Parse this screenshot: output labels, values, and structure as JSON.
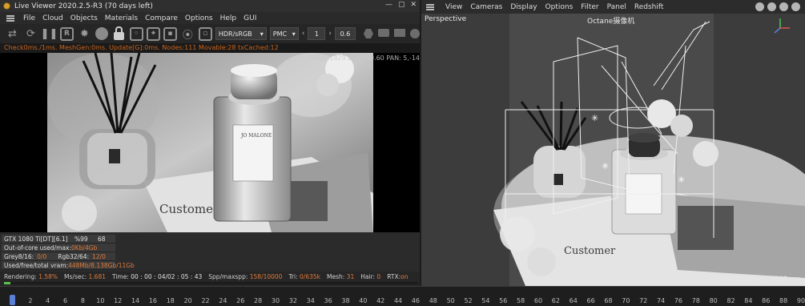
{
  "live_viewer": {
    "title": "Live Viewer 2020.2.5-R3 (70 days left)",
    "menu": [
      "File",
      "Cloud",
      "Objects",
      "Materials",
      "Compare",
      "Options",
      "Help",
      "GUI"
    ],
    "toolbar": {
      "color_space": "HDR/sRGB",
      "kernel": "PMC",
      "stepper_value": "1",
      "zoom_value": "0.6"
    },
    "status_line": "Check0ms./1ms. MeshGen:0ms. Update[G]:0ms. Nodes:111 Movable:28 txCached:12",
    "zoom_readout": "1000*1829 ZOOM:0.60  PAN: 5,-14",
    "gpu": {
      "row1_name": "GTX 1080 Ti[DT][6.1]",
      "row1_pct": "%99",
      "row1_temp": "68",
      "row2_label": "Out-of-core used/max:",
      "row2_value": "0Kb/4Gb",
      "row3_label": "Grey8/16:",
      "row3_value": "0/0",
      "row3_label2": "Rgb32/64:",
      "row3_value2": "12/0",
      "row4_label": "Used/free/total vram:",
      "row4_value": "448Mb/8.138Gb/11Gb"
    },
    "stats": {
      "rendering_label": "Rendering:",
      "rendering_value": "1.58%",
      "ms_label": "Ms/sec:",
      "ms_value": "1.681",
      "time_label": "Time:",
      "time_value": "00 : 00 : 04/02 : 05 : 43",
      "spp_label": "Spp/maxspp:",
      "spp_value": "158/10000",
      "tri_label": "Tri:",
      "tri_value": "0/635k",
      "mesh_label": "Mesh:",
      "mesh_value": "31",
      "hair_label": "Hair:",
      "hair_value": "0",
      "rtx_label": "RTX:",
      "rtx_value": "on"
    },
    "progress": 0.0158,
    "accent_color": "#e07a3a",
    "status_color": "#c9641d",
    "progress_color": "#59c24f"
  },
  "viewport": {
    "menu": [
      "View",
      "Cameras",
      "Display",
      "Options",
      "Filter",
      "Panel",
      "Redshift"
    ],
    "view_name": "Perspective",
    "camera_name": "Octane摄像机",
    "grid_spacing": "Grid Spacing : 1000 cm",
    "top_icons": [
      "move-view-icon",
      "pan-view-icon",
      "zoom-view-icon",
      "rotate-view-icon"
    ]
  },
  "timeline": {
    "ticks": [
      "0",
      "2",
      "4",
      "6",
      "8",
      "10",
      "12",
      "14",
      "16",
      "18",
      "20",
      "22",
      "24",
      "26",
      "28",
      "30",
      "32",
      "34",
      "36",
      "38",
      "40",
      "42",
      "44",
      "46",
      "48",
      "50",
      "52",
      "54",
      "56",
      "58",
      "60",
      "62",
      "64",
      "66",
      "68",
      "70",
      "72",
      "74",
      "76",
      "78",
      "80",
      "82",
      "84",
      "86",
      "88",
      "90"
    ],
    "current_frame": "0"
  }
}
